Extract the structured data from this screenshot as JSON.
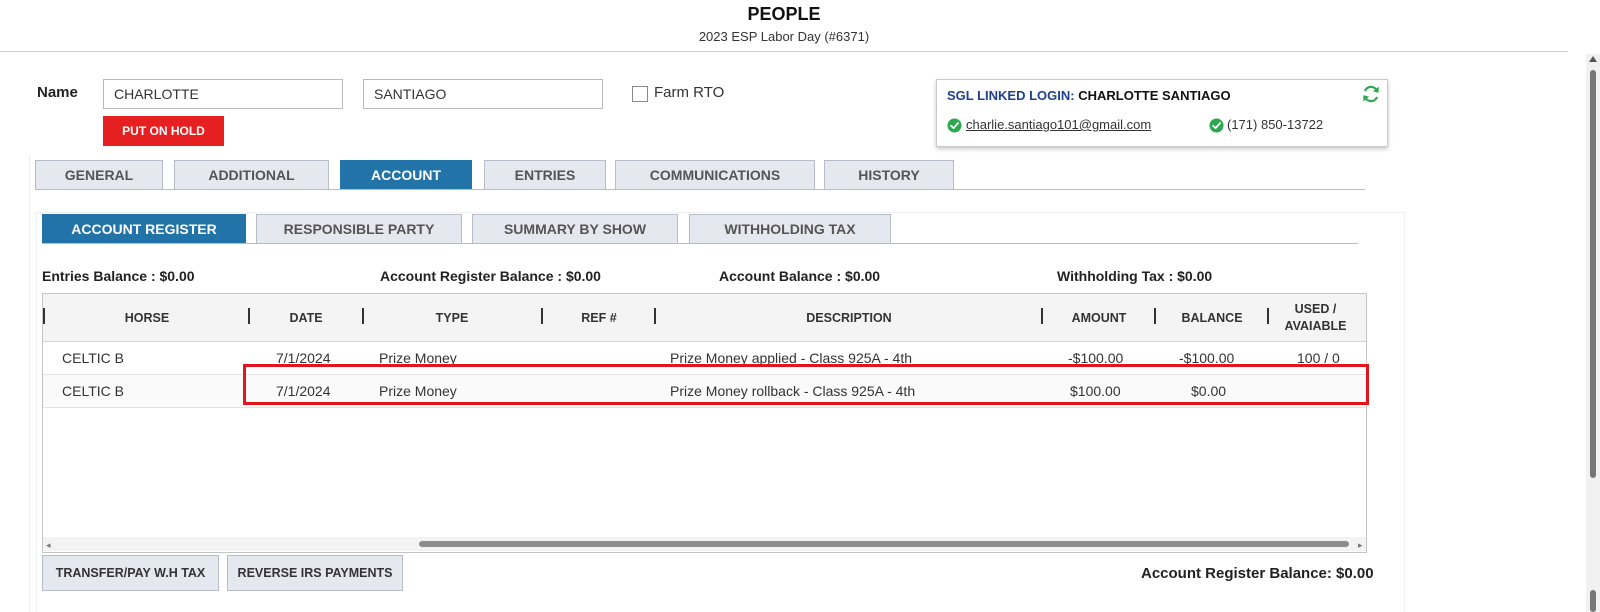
{
  "header": {
    "title": "PEOPLE",
    "subtitle": "2023 ESP Labor Day (#6371)"
  },
  "person": {
    "name_label": "Name",
    "first_name": "CHARLOTTE",
    "last_name": "SANTIAGO",
    "farm_rto_label": "Farm RTO",
    "farm_rto_checked": false,
    "put_on_hold_label": "PUT ON HOLD"
  },
  "linked_login": {
    "label": "SGL LINKED LOGIN:",
    "name": "CHARLOTTE SANTIAGO",
    "email": "charlie.santiago101@gmail.com",
    "phone": "(171) 850-13722",
    "icons": {
      "refresh": "refresh-icon",
      "verified": "check-circle-icon"
    }
  },
  "tabs": [
    {
      "label": "GENERAL",
      "active": false
    },
    {
      "label": "ADDITIONAL",
      "active": false
    },
    {
      "label": "ACCOUNT",
      "active": true
    },
    {
      "label": "ENTRIES",
      "active": false
    },
    {
      "label": "COMMUNICATIONS",
      "active": false
    },
    {
      "label": "HISTORY",
      "active": false
    }
  ],
  "subtabs": [
    {
      "label": "ACCOUNT REGISTER",
      "active": true
    },
    {
      "label": "RESPONSIBLE PARTY",
      "active": false
    },
    {
      "label": "SUMMARY BY SHOW",
      "active": false
    },
    {
      "label": "WITHHOLDING TAX",
      "active": false
    }
  ],
  "balances": {
    "entries": "Entries Balance : $0.00",
    "account_register": "Account Register Balance : $0.00",
    "account": "Account Balance : $0.00",
    "withholding": "Withholding Tax : $0.00"
  },
  "table": {
    "columns": [
      "HORSE",
      "DATE",
      "TYPE",
      "REF #",
      "DESCRIPTION",
      "AMOUNT",
      "BALANCE",
      "USED / AVAIABLE"
    ],
    "rows": [
      {
        "horse": "CELTIC B",
        "date": "7/1/2024",
        "type": "Prize Money",
        "ref": "",
        "description": "Prize Money applied - Class 925A - 4th",
        "amount": "-$100.00",
        "balance": "-$100.00",
        "used": "100 / 0"
      },
      {
        "horse": "CELTIC B",
        "date": "7/1/2024",
        "type": "Prize Money",
        "ref": "",
        "description": "Prize Money rollback - Class 925A - 4th",
        "amount": "$100.00",
        "balance": "$0.00",
        "used": ""
      }
    ]
  },
  "buttons": {
    "transfer": "TRANSFER/PAY W.H TAX",
    "reverse": "REVERSE IRS PAYMENTS"
  },
  "footer_balance": "Account Register Balance: $0.00",
  "colors": {
    "active_tab": "#2273a8",
    "hold_button": "#e62020",
    "highlight": "#e3141b",
    "login_label": "#1f3f8f",
    "check": "#2ea84f"
  }
}
